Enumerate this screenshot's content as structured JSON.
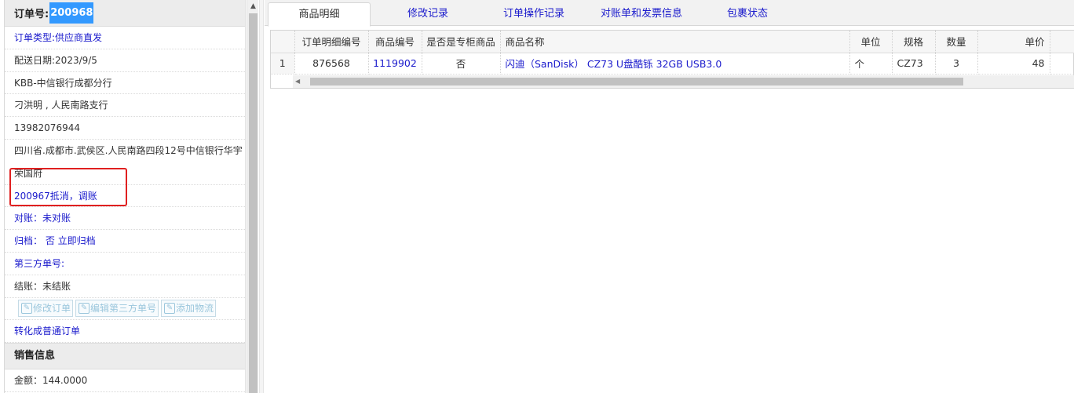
{
  "order": {
    "label": "订单号:",
    "number": "200968"
  },
  "info_rows": [
    {
      "text": "订单类型:供应商直发",
      "blue": true
    },
    {
      "text": "配送日期:2023/9/5",
      "blue": false
    },
    {
      "text": "KBB-中信银行成都分行",
      "blue": false
    },
    {
      "text": "刁洪明 , 人民南路支行",
      "blue": false
    },
    {
      "text": "13982076944",
      "blue": false
    }
  ],
  "address": "四川省.成都市.武侯区.人民南路四段12号中信银行华宇荣国府",
  "remark": "200967抵消，调账",
  "reconcile": "对账：未对账",
  "archive": "归档： 否 立即归档",
  "third_party": "第三方单号:",
  "settle": "结账：未结账",
  "buttons": {
    "edit_order": "修改订单",
    "edit_third": "编辑第三方单号",
    "add_logistics": "添加物流"
  },
  "convert_link": "转化成普通订单",
  "sales_section": "销售信息",
  "amount": "金额：144.0000",
  "tabs": [
    "商品明细",
    "修改记录",
    "订单操作记录",
    "对账单和发票信息",
    "包裹状态"
  ],
  "table": {
    "headers": [
      "订单明细编号",
      "商品编号",
      "是否是专柜商品",
      "商品名称",
      "单位",
      "规格",
      "数量",
      "单价"
    ],
    "rows": [
      {
        "row_no": "1",
        "detail_id": "876568",
        "product_id": "1119902",
        "is_counter": "否",
        "name": "闪迪（SanDisk） CZ73 U盘酷铄 32GB USB3.0",
        "unit": "个",
        "spec": "CZ73",
        "qty": "3",
        "price": "48"
      }
    ]
  },
  "colors": {
    "link": "#1a1acc",
    "highlight": "#3399ff",
    "annotation_box": "#e02020"
  }
}
